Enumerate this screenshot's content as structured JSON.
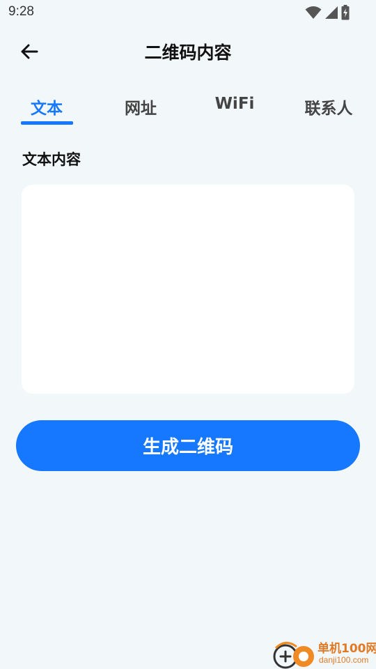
{
  "status_bar": {
    "time": "9:28",
    "icons": [
      "wifi-icon",
      "cell-signal-icon",
      "battery-charging-icon"
    ]
  },
  "header": {
    "title": "二维码内容",
    "back_icon": "arrow-left-icon"
  },
  "tabs": [
    {
      "label": "文本",
      "active": true
    },
    {
      "label": "网址",
      "active": false
    },
    {
      "label": "WiFi",
      "active": false
    },
    {
      "label": "联系人",
      "active": false
    }
  ],
  "content": {
    "section_label": "文本内容",
    "text_value": "",
    "text_placeholder": ""
  },
  "actions": {
    "generate_label": "生成二维码"
  },
  "colors": {
    "accent": "#1677ff",
    "background": "#f2f7f9",
    "card": "#ffffff"
  },
  "watermark": {
    "name": "单机100网",
    "url": "danji100.com"
  }
}
